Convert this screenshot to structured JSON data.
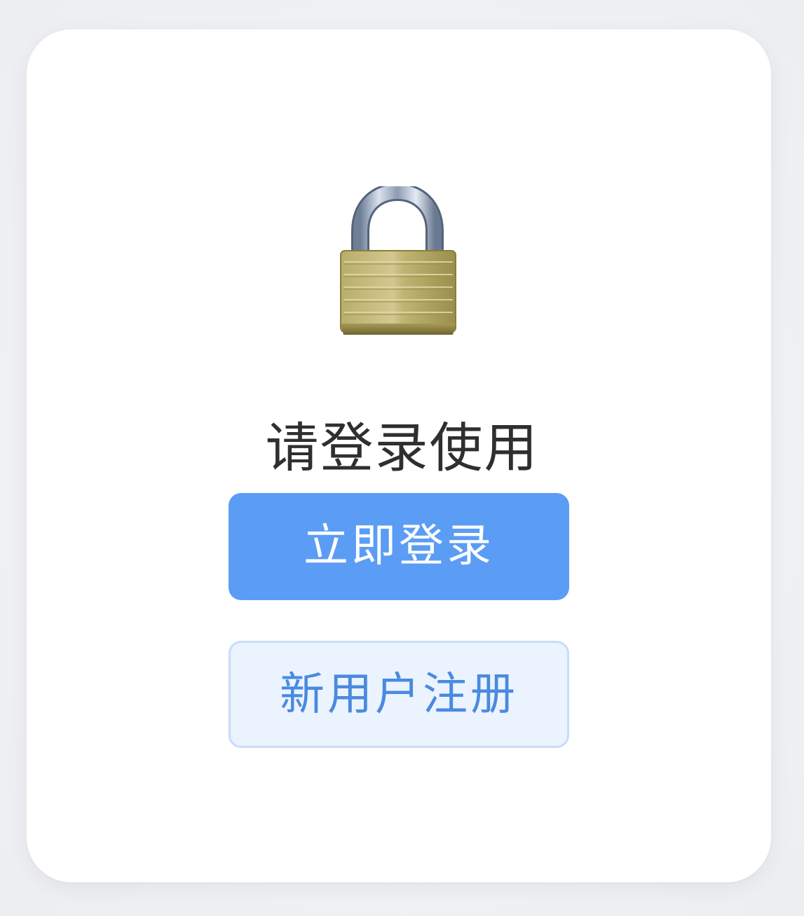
{
  "auth_gate": {
    "lock_icon": "padlock-icon",
    "prompt": "请登录使用",
    "login_label": "立即登录",
    "register_label": "新用户注册"
  },
  "colors": {
    "primary": "#5b9cf5",
    "secondary_bg": "#ebf3fe",
    "secondary_border": "#c7dcf7",
    "secondary_text": "#4a8ae0",
    "prompt_text": "#2f2f2f",
    "card_bg": "#ffffff"
  }
}
